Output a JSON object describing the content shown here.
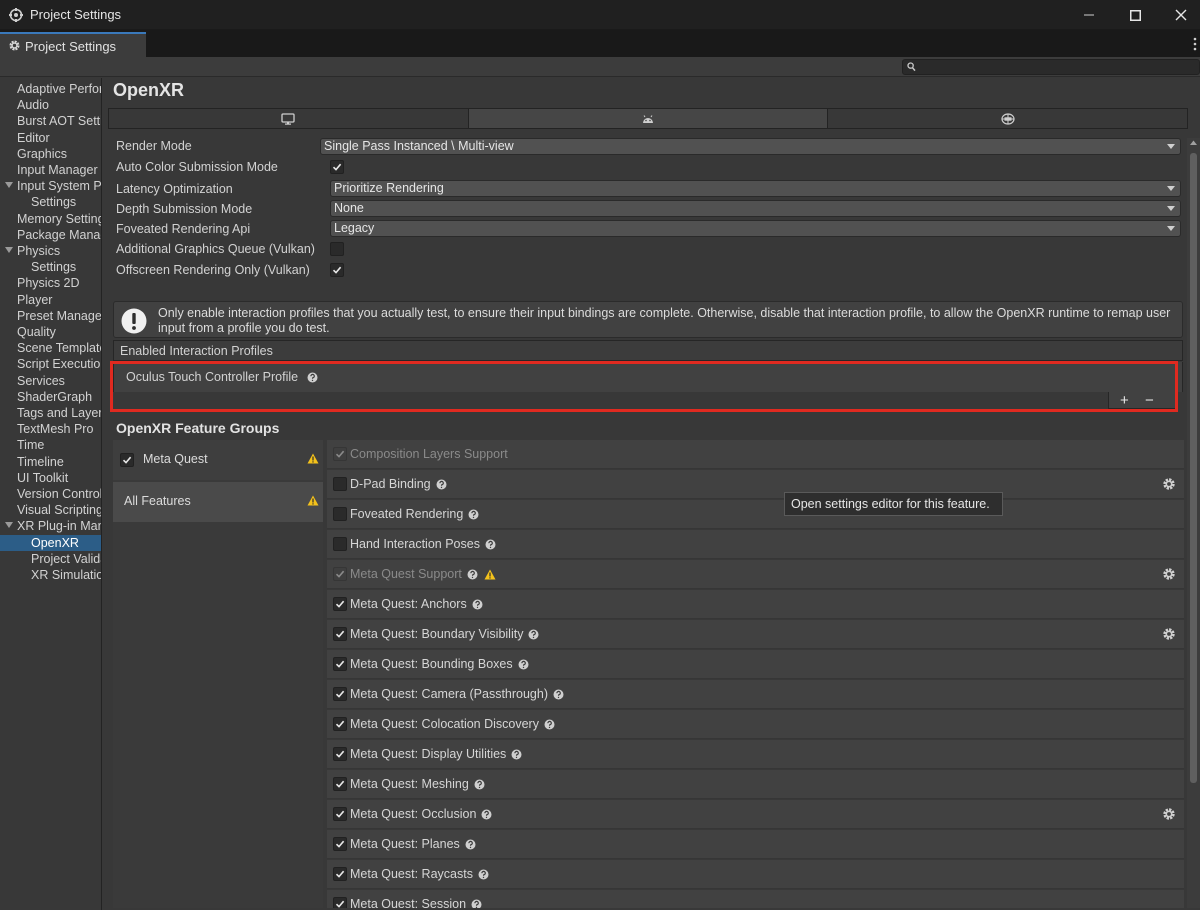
{
  "window": {
    "title": "Project Settings",
    "tab_label": "Project Settings"
  },
  "sidebar": {
    "items": [
      {
        "label": "Adaptive Performance",
        "indent": 0
      },
      {
        "label": "Audio",
        "indent": 0
      },
      {
        "label": "Burst AOT Settings",
        "indent": 0
      },
      {
        "label": "Editor",
        "indent": 0
      },
      {
        "label": "Graphics",
        "indent": 0
      },
      {
        "label": "Input Manager",
        "indent": 0
      },
      {
        "label": "Input System Package",
        "indent": 0,
        "expandable": true
      },
      {
        "label": "Settings",
        "indent": 1
      },
      {
        "label": "Memory Settings",
        "indent": 0
      },
      {
        "label": "Package Manager",
        "indent": 0
      },
      {
        "label": "Physics",
        "indent": 0,
        "expandable": true
      },
      {
        "label": "Settings",
        "indent": 1
      },
      {
        "label": "Physics 2D",
        "indent": 0
      },
      {
        "label": "Player",
        "indent": 0
      },
      {
        "label": "Preset Manager",
        "indent": 0
      },
      {
        "label": "Quality",
        "indent": 0
      },
      {
        "label": "Scene Template",
        "indent": 0
      },
      {
        "label": "Script Execution Order",
        "indent": 0
      },
      {
        "label": "Services",
        "indent": 0
      },
      {
        "label": "ShaderGraph",
        "indent": 0
      },
      {
        "label": "Tags and Layers",
        "indent": 0
      },
      {
        "label": "TextMesh Pro",
        "indent": 0
      },
      {
        "label": "Time",
        "indent": 0
      },
      {
        "label": "Timeline",
        "indent": 0
      },
      {
        "label": "UI Toolkit",
        "indent": 0
      },
      {
        "label": "Version Control",
        "indent": 0
      },
      {
        "label": "Visual Scripting",
        "indent": 0
      },
      {
        "label": "XR Plug-in Management",
        "indent": 0,
        "expandable": true
      },
      {
        "label": "OpenXR",
        "indent": 1,
        "selected": true
      },
      {
        "label": "Project Validation",
        "indent": 1
      },
      {
        "label": "XR Simulation",
        "indent": 1
      }
    ]
  },
  "main": {
    "title": "OpenXR",
    "platform_tabs": [
      {
        "icon": "monitor-icon",
        "active": false
      },
      {
        "icon": "android-icon",
        "active": true
      },
      {
        "icon": "webgl-icon",
        "active": false
      }
    ],
    "properties": [
      {
        "label": "Render Mode",
        "type": "dropdown",
        "value": "Single Pass Instanced \\ Multi-view"
      },
      {
        "label": "Auto Color Submission Mode",
        "type": "checkbox",
        "checked": true
      },
      {
        "label": "Latency Optimization",
        "type": "dropdown",
        "value": "Prioritize Rendering"
      },
      {
        "label": "Depth Submission Mode",
        "type": "dropdown",
        "value": "None"
      },
      {
        "label": "Foveated Rendering Api",
        "type": "dropdown",
        "value": "Legacy"
      },
      {
        "label": "Additional Graphics Queue (Vulkan)",
        "type": "checkbox",
        "checked": false
      },
      {
        "label": "Offscreen Rendering Only (Vulkan)",
        "type": "checkbox",
        "checked": true
      }
    ],
    "help_text": "Only enable interaction profiles that you actually test, to ensure their input bindings are complete. Otherwise, disable that interaction profile, to allow the OpenXR runtime to remap user input from a profile you do test.",
    "interaction_profiles": {
      "header": "Enabled Interaction Profiles",
      "items": [
        "Oculus Touch Controller Profile"
      ],
      "add_label": "+",
      "remove_label": "−"
    },
    "feature_groups": {
      "title": "OpenXR Feature Groups",
      "groups": [
        {
          "label": "Meta Quest",
          "checked": true,
          "warning": true
        },
        {
          "label": "All Features",
          "warning": true,
          "selected": true
        }
      ],
      "features": [
        {
          "label": "Composition Layers Support",
          "checked": true,
          "disabled": true,
          "help": false,
          "warning": false,
          "gear": false
        },
        {
          "label": "D-Pad Binding",
          "checked": false,
          "help": true,
          "gear": true
        },
        {
          "label": "Foveated Rendering",
          "checked": false,
          "help": true
        },
        {
          "label": "Hand Interaction Poses",
          "checked": false,
          "help": true
        },
        {
          "label": "Meta Quest Support",
          "checked": true,
          "disabled": true,
          "help": true,
          "warning": true,
          "gear": true
        },
        {
          "label": "Meta Quest: Anchors",
          "checked": true,
          "help": true
        },
        {
          "label": "Meta Quest: Boundary Visibility",
          "checked": true,
          "help": true,
          "gear": true
        },
        {
          "label": "Meta Quest: Bounding Boxes",
          "checked": true,
          "help": true
        },
        {
          "label": "Meta Quest: Camera (Passthrough)",
          "checked": true,
          "help": true
        },
        {
          "label": "Meta Quest: Colocation Discovery",
          "checked": true,
          "help": true
        },
        {
          "label": "Meta Quest: Display Utilities",
          "checked": true,
          "help": true
        },
        {
          "label": "Meta Quest: Meshing",
          "checked": true,
          "help": true
        },
        {
          "label": "Meta Quest: Occlusion",
          "checked": true,
          "help": true,
          "gear": true
        },
        {
          "label": "Meta Quest: Planes",
          "checked": true,
          "help": true
        },
        {
          "label": "Meta Quest: Raycasts",
          "checked": true,
          "help": true
        },
        {
          "label": "Meta Quest: Session",
          "checked": true,
          "help": true
        }
      ]
    },
    "tooltip": "Open settings editor for this feature."
  },
  "colors": {
    "selection": "#2c5d87",
    "highlight": "#e02a20",
    "warning": "#f4c21b"
  }
}
